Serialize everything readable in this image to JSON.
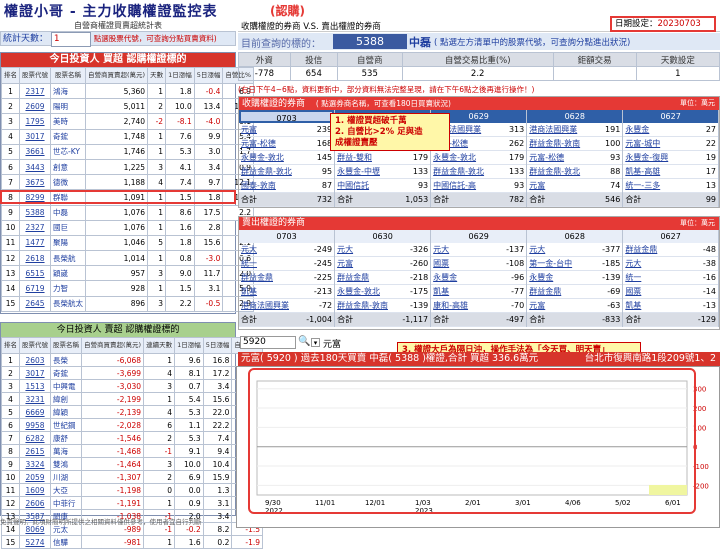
{
  "header": {
    "title": "權證小哥 - 主力收購權證監控表",
    "tag": "(認購)"
  },
  "subtitle_left": "自營商權證買賣超統計表",
  "stats": {
    "label": "統計天數：",
    "value": "1",
    "hint": "點選股票代號，可查詢分點買賣資料)"
  },
  "right_header": {
    "title": "收購權證的券商 V.S. 賣出權證的券商",
    "date_label": "日期設定：",
    "date_value": "20230703"
  },
  "query": {
    "label": "目前查詢的標的：",
    "code": "5388",
    "name": "中磊",
    "hint": "( 點選左方清單中的股票代號，可查詢分點進出狀況)"
  },
  "summary": {
    "headers": [
      "外資",
      "投信",
      "自營商",
      "自營交易比重(%)",
      "鉅額交易",
      "天數設定"
    ],
    "values": [
      "-778",
      "654",
      "535",
      "2.2",
      "",
      "1"
    ]
  },
  "notice": "(右日下午4~6點，資料更新中，部分資料無法完整呈現，請在下午6點之後再進行操作！)",
  "buy_section": {
    "title": "收購權證的券商",
    "sub": "( 點選券商名稱，可查看180日買賣狀況)",
    "unit": "單位：萬元",
    "dates": [
      "0703",
      "0630",
      "0629",
      "0628",
      "0627"
    ],
    "columns": [
      [
        [
          "元富",
          "239"
        ],
        [
          "元富-松德",
          "168"
        ],
        [
          "永豐金-敦北",
          "145"
        ],
        [
          "群益金鼎-敦北",
          "95"
        ],
        [
          "國泰-敦南",
          "87"
        ],
        [
          "合計",
          "732"
        ]
      ],
      [
        [
          "",
          "313"
        ],
        [
          "",
          "262"
        ],
        [
          "群益-雙和",
          "179"
        ],
        [
          "永豐金-中壢",
          "133"
        ],
        [
          "中國信託",
          "93"
        ],
        [
          "合計",
          "1,053"
        ]
      ],
      [
        [
          "港商法國興業",
          "313"
        ],
        [
          "元富-松德",
          "262"
        ],
        [
          "永豐金-敦北",
          "179"
        ],
        [
          "群益金鼎-敦北",
          "133"
        ],
        [
          "中國信託-高",
          "93"
        ],
        [
          "合計",
          "782"
        ]
      ],
      [
        [
          "港商法國興業",
          "191"
        ],
        [
          "群益金鼎-敦南",
          "100"
        ],
        [
          "元富-松德",
          "93"
        ],
        [
          "群益金鼎-敦北",
          "88"
        ],
        [
          "元富",
          "74"
        ],
        [
          "合計",
          "546"
        ]
      ],
      [
        [
          "永豐金",
          "27"
        ],
        [
          "元富-城中",
          "22"
        ],
        [
          "永豐金-復興",
          "19"
        ],
        [
          "凱基-高雄",
          "17"
        ],
        [
          "統一-三多",
          "13"
        ],
        [
          "合計",
          "99"
        ]
      ]
    ]
  },
  "callouts": {
    "c12": [
      "1. 權證買超破千萬",
      "2. 自營比>2% 足與造",
      "   成權證賣壓"
    ],
    "c3": "3. 權證大戶為隔日沖，操作手法為「今天買、明天賣」"
  },
  "sell_section": {
    "title": "賣出權證的券商",
    "unit": "單位：萬元",
    "dates": [
      "0703",
      "0630",
      "0629",
      "0628",
      "0627"
    ],
    "columns": [
      [
        [
          "元大",
          "-249"
        ],
        [
          "統一",
          "-245"
        ],
        [
          "群益金鼎",
          "-225"
        ],
        [
          "凱基",
          "-213"
        ],
        [
          "港商法國興業",
          "-72"
        ],
        [
          "合計",
          "-1,004"
        ]
      ],
      [
        [
          "元大",
          "-326"
        ],
        [
          "元富",
          "-260"
        ],
        [
          "群益金鼎",
          "-218"
        ],
        [
          "永豐金-敦北",
          "-175"
        ],
        [
          "群益金鼎-敦南",
          "-139"
        ],
        [
          "合計",
          "-1,117"
        ]
      ],
      [
        [
          "元大",
          "-137"
        ],
        [
          "國票",
          "-108"
        ],
        [
          "永豐金",
          "-96"
        ],
        [
          "凱基",
          "-77"
        ],
        [
          "康和-高雄",
          "-70"
        ],
        [
          "合計",
          "-497"
        ]
      ],
      [
        [
          "元大",
          "-377"
        ],
        [
          "第一金-台中",
          "-185"
        ],
        [
          "永豐金",
          "-139"
        ],
        [
          "群益金鼎",
          "-69"
        ],
        [
          "元富",
          "-63"
        ],
        [
          "合計",
          "-833"
        ]
      ],
      [
        [
          "群益金鼎",
          "-48"
        ],
        [
          "元大",
          "-38"
        ],
        [
          "統一",
          "-16"
        ],
        [
          "國票",
          "-14"
        ],
        [
          "凱基",
          "-13"
        ],
        [
          "合計",
          "-129"
        ]
      ]
    ]
  },
  "left_buy": {
    "title": "今日投資人 買超 認購權證標的",
    "headers": [
      "排名",
      "股票代號",
      "股票名稱",
      "自營商買賣超(萬元)",
      "天數",
      "1日漲幅",
      "5日漲幅",
      "自營比%"
    ],
    "rows": [
      [
        "1",
        "2317",
        "鴻海",
        "5,360",
        "1",
        "1.8",
        "-0.4",
        "6.9"
      ],
      [
        "2",
        "2609",
        "陽明",
        "5,011",
        "2",
        "10.0",
        "13.4",
        "10.9"
      ],
      [
        "3",
        "1795",
        "美時",
        "2,740",
        "-2",
        "-8.1",
        "-4.0",
        "0.1"
      ],
      [
        "4",
        "3017",
        "奇鋐",
        "1,748",
        "1",
        "7.6",
        "9.9",
        "5.4"
      ],
      [
        "5",
        "3661",
        "世芯-KY",
        "1,746",
        "1",
        "5.3",
        "3.0",
        "1.7"
      ],
      [
        "6",
        "3443",
        "創意",
        "1,225",
        "3",
        "4.1",
        "3.4",
        "0.9"
      ],
      [
        "7",
        "3675",
        "德微",
        "1,188",
        "4",
        "7.4",
        "9.7",
        "12.1"
      ],
      [
        "8",
        "8299",
        "群聯",
        "1,091",
        "1",
        "1.5",
        "1.8",
        "12.1"
      ],
      [
        "9",
        "5388",
        "中磊",
        "1,076",
        "1",
        "8.6",
        "17.5",
        "2.2"
      ],
      [
        "10",
        "2327",
        "國巨",
        "1,076",
        "1",
        "1.6",
        "2.8",
        "3.6"
      ],
      [
        "11",
        "1477",
        "聚陽",
        "1,046",
        "5",
        "1.8",
        "15.6",
        "2.1"
      ],
      [
        "12",
        "2618",
        "長榮航",
        "1,014",
        "1",
        "0.8",
        "-3.0",
        "0.6"
      ],
      [
        "13",
        "6515",
        "穎崴",
        "957",
        "3",
        "9.0",
        "11.7",
        "2.0"
      ],
      [
        "14",
        "6719",
        "力智",
        "928",
        "1",
        "1.5",
        "3.1",
        "5.9"
      ],
      [
        "15",
        "2645",
        "長榮航太",
        "896",
        "3",
        "2.2",
        "-0.5",
        "2.9"
      ]
    ]
  },
  "left_sell": {
    "title": "今日投資人 賣超 認購權證標的",
    "headers": [
      "排名",
      "股票代號",
      "股票名稱",
      "自營商買賣超(萬元)",
      "連續天數",
      "1日漲幅",
      "5日漲幅",
      "自營比%"
    ],
    "rows": [
      [
        "1",
        "2603",
        "長榮",
        "-6,068",
        "1",
        "9.6",
        "16.8",
        "-2.4"
      ],
      [
        "2",
        "3017",
        "奇鋐",
        "-3,699",
        "4",
        "8.1",
        "17.2",
        "0.2"
      ],
      [
        "3",
        "1513",
        "中興電",
        "-3,030",
        "3",
        "0.7",
        "3.4",
        "-2.3"
      ],
      [
        "4",
        "3231",
        "緯創",
        "-2,199",
        "1",
        "5.4",
        "15.6",
        "-0.2"
      ],
      [
        "5",
        "6669",
        "緯穎",
        "-2,139",
        "4",
        "5.3",
        "22.0",
        "0.2"
      ],
      [
        "6",
        "9958",
        "世紀鋼",
        "-2,028",
        "6",
        "1.1",
        "22.2",
        "-3.2"
      ],
      [
        "7",
        "6282",
        "康舒",
        "-1,546",
        "2",
        "5.3",
        "7.4",
        "-0.1"
      ],
      [
        "8",
        "2615",
        "萬海",
        "-1,468",
        "-1",
        "9.1",
        "9.4",
        "-1.9"
      ],
      [
        "9",
        "3324",
        "雙鴻",
        "-1,464",
        "3",
        "10.0",
        "10.4",
        "0.7"
      ],
      [
        "10",
        "2059",
        "川湖",
        "-1,307",
        "2",
        "6.9",
        "15.9",
        "0.4"
      ],
      [
        "11",
        "1609",
        "大亞",
        "-1,198",
        "0",
        "0.0",
        "1.3",
        "-2.2"
      ],
      [
        "12",
        "2606",
        "中菲行",
        "-1,191",
        "1",
        "0.9",
        "3.1",
        "-31.1"
      ],
      [
        "13",
        "3587",
        "閎康",
        "-1,038",
        "-1",
        "2.0",
        "3.4",
        "-5.4"
      ],
      [
        "14",
        "8069",
        "元太",
        "-989",
        "-1",
        "-0.2",
        "8.2",
        "-1.5"
      ],
      [
        "15",
        "5274",
        "信驊",
        "-981",
        "1",
        "1.6",
        "0.2",
        "-1.9"
      ]
    ]
  },
  "disclaimer": "免責聲明：此項財簡明所提供之相關資料僅供參考，使用者宜自行判斷",
  "chart_toolbar": {
    "code_value": "5920",
    "broker": "元富"
  },
  "chart_data": {
    "type": "bar",
    "title": "元富( 5920 ) 過去180天買賣 中磊( 5388 )權證,合計 買超 336.6萬元",
    "address": "台北市復興南路1段209號1、2",
    "x_tick_labels": [
      "9/30\n2022",
      "11/01",
      "12/01",
      "1/03\n2023",
      "2/01",
      "3/01",
      "4/06",
      "5/02",
      "6/01"
    ],
    "y_ticks": [
      300,
      200,
      100,
      0,
      -100,
      -200
    ],
    "ylim": [
      -250,
      340
    ]
  },
  "colors": {
    "red": "#e53935",
    "blue": "#2f5fa7",
    "green": "#a8d08d",
    "yellow": "#fff7a8"
  }
}
